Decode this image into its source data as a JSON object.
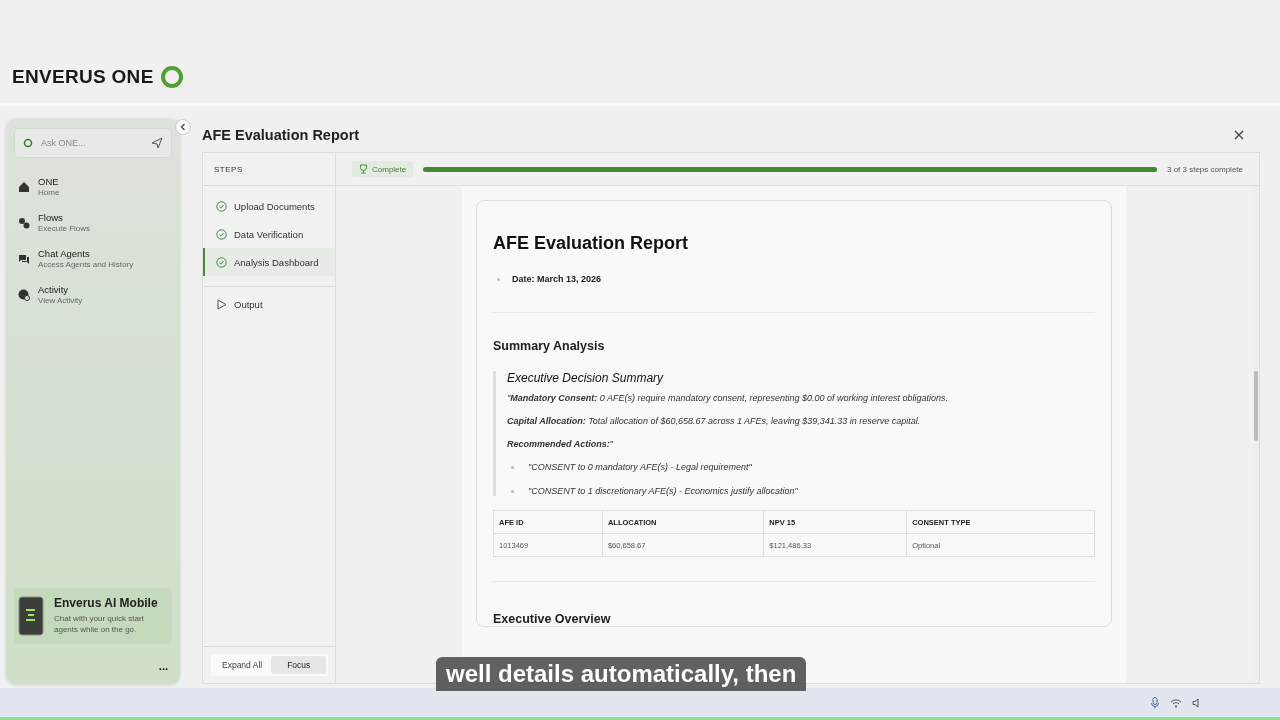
{
  "logo": {
    "text": "ENVERUS ONE"
  },
  "sidebar": {
    "search": {
      "placeholder": "Ask ONE..."
    },
    "items": [
      {
        "title": "ONE",
        "subtitle": "Home",
        "kind": "home"
      },
      {
        "title": "Flows",
        "subtitle": "Execute Flows",
        "kind": "flows"
      },
      {
        "title": "Chat Agents",
        "subtitle": "Access Agents and History",
        "kind": "chat"
      },
      {
        "title": "Activity",
        "subtitle": "View Activity",
        "kind": "activity"
      }
    ],
    "promo": {
      "title": "Enverus AI Mobile",
      "text": "Chat with your quick start agents while on the go."
    },
    "more": "..."
  },
  "panel": {
    "title": "AFE Evaluation Report",
    "steps_heading": "STEPS",
    "steps": [
      {
        "label": "Upload Documents",
        "kind": "done",
        "selected": false
      },
      {
        "label": "Data Verification",
        "kind": "done",
        "selected": false
      },
      {
        "label": "Analysis Dashboard",
        "kind": "done",
        "selected": true
      },
      {
        "label": "Output",
        "kind": "pending",
        "selected": false
      }
    ],
    "footer_buttons": [
      {
        "label": "Expand All",
        "selected": false
      },
      {
        "label": "Focus",
        "selected": true
      }
    ],
    "status": {
      "badge": "Complete",
      "level": 1,
      "reading": "3 of 3 steps complete"
    }
  },
  "report": {
    "title": "AFE Evaluation Report",
    "date": "Date: March 13, 2026",
    "section": "Summary Analysis",
    "summary_title": "Executive Decision Summary",
    "paragraphs": [
      "\"**Mandatory Consent:** 0 AFE(s) require mandatory consent, representing $0.00 of working interest obligations.",
      "**Capital Allocation:** Total allocation of $60,658.67 across 1 AFEs, leaving $39,341.33 in reserve capital.",
      "**Recommended Actions:**\""
    ],
    "actions": [
      "\"CONSENT to 0 mandatory AFE(s) - Legal requirement\"",
      "\"CONSENT to 1 discretionary AFE(s) - Economics justify allocation\""
    ],
    "table": {
      "columns": [
        "AFE ID",
        "ALLOCATION",
        "NPV 15",
        "CONSENT TYPE"
      ],
      "rows": [
        [
          "1013469",
          "$60,658.67",
          "$121,486.33",
          "Optional"
        ]
      ]
    },
    "next_section": "Executive Overview"
  },
  "caption": "well details automatically, then"
}
